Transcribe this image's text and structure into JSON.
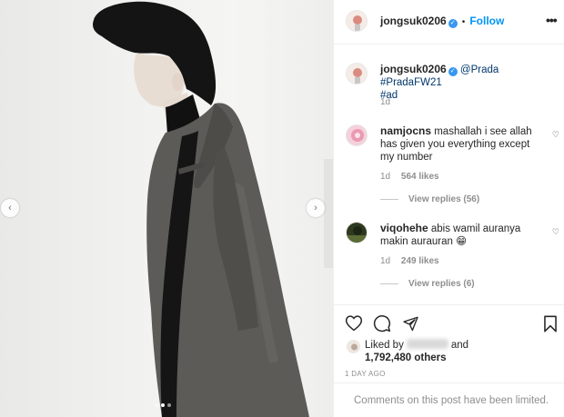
{
  "post": {
    "carousel": {
      "slide_count": 3,
      "active_slide": 2
    }
  },
  "header": {
    "username": "jongsuk0206",
    "separator": "•",
    "follow_label": "Follow",
    "more_icon": "more-horizontal-icon"
  },
  "caption": {
    "username": "jongsuk0206",
    "mention": "@Prada",
    "hashtags": "#PradaFW21",
    "hashtag_ad": "#ad",
    "time": "1d"
  },
  "comments": [
    {
      "username": "namjocns",
      "text_line1": "mashallah i see allah",
      "text_line2": "has given you everything except",
      "text_line3": "my number",
      "time": "1d",
      "likes": "564 likes",
      "view_replies": "View replies (56)"
    },
    {
      "username": "viqohehe",
      "text_line1": "abis wamil auranya",
      "text_line2": "makin aurauran 😁",
      "time": "1d",
      "likes": "249 likes",
      "view_replies": "View replies (6)"
    }
  ],
  "actions": {
    "liked_by_prefix": "Liked by",
    "liked_by_suffix": "and",
    "others": "1,792,480 others",
    "time_ago": "1 DAY AGO",
    "comments_limited": "Comments on this post have been limited."
  },
  "colors": {
    "accent": "#0095f6",
    "verified": "#3897f0",
    "suit": "#5c5b58"
  }
}
